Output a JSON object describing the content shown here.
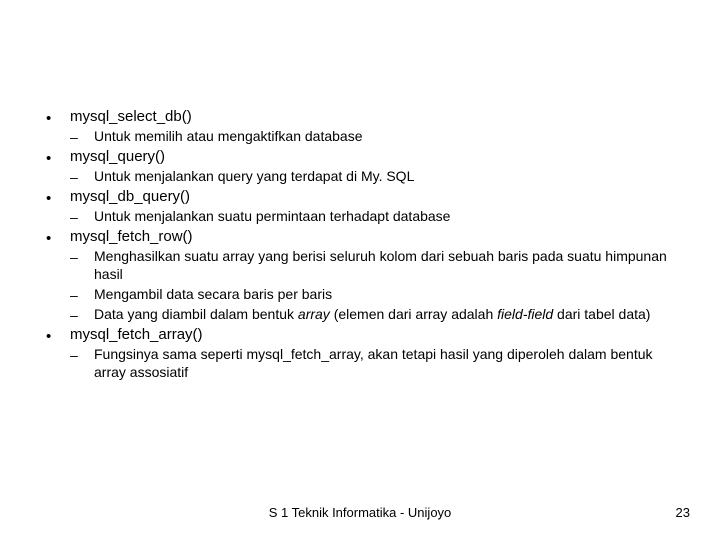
{
  "items": [
    {
      "title": "mysql_select_db()",
      "subs": [
        {
          "segments": [
            "Untuk memilih atau mengaktifkan database"
          ]
        }
      ]
    },
    {
      "title": "mysql_query()",
      "subs": [
        {
          "segments": [
            "Untuk menjalankan query yang terdapat di My. SQL"
          ]
        }
      ]
    },
    {
      "title": "mysql_db_query()",
      "subs": [
        {
          "segments": [
            "Untuk menjalankan suatu permintaan terhadapt database"
          ]
        }
      ]
    },
    {
      "title": "mysql_fetch_row()",
      "subs": [
        {
          "segments": [
            "Menghasilkan suatu array yang berisi seluruh kolom dari sebuah baris pada suatu himpunan hasil"
          ]
        },
        {
          "segments": [
            "Mengambil data secara baris per baris"
          ]
        },
        {
          "segments": [
            "Data yang diambil dalam bentuk ",
            {
              "italic": true,
              "text": "array"
            },
            " (elemen dari array adalah ",
            {
              "italic": true,
              "text": "field-field"
            },
            " dari tabel data)"
          ]
        }
      ]
    },
    {
      "title": "mysql_fetch_array()",
      "subs": [
        {
          "segments": [
            "Fungsinya sama seperti mysql_fetch_array, akan tetapi hasil yang diperoleh dalam bentuk array assosiatif"
          ]
        }
      ]
    }
  ],
  "footer_center": "S 1 Teknik Informatika - Unijoyo",
  "footer_right": "23"
}
